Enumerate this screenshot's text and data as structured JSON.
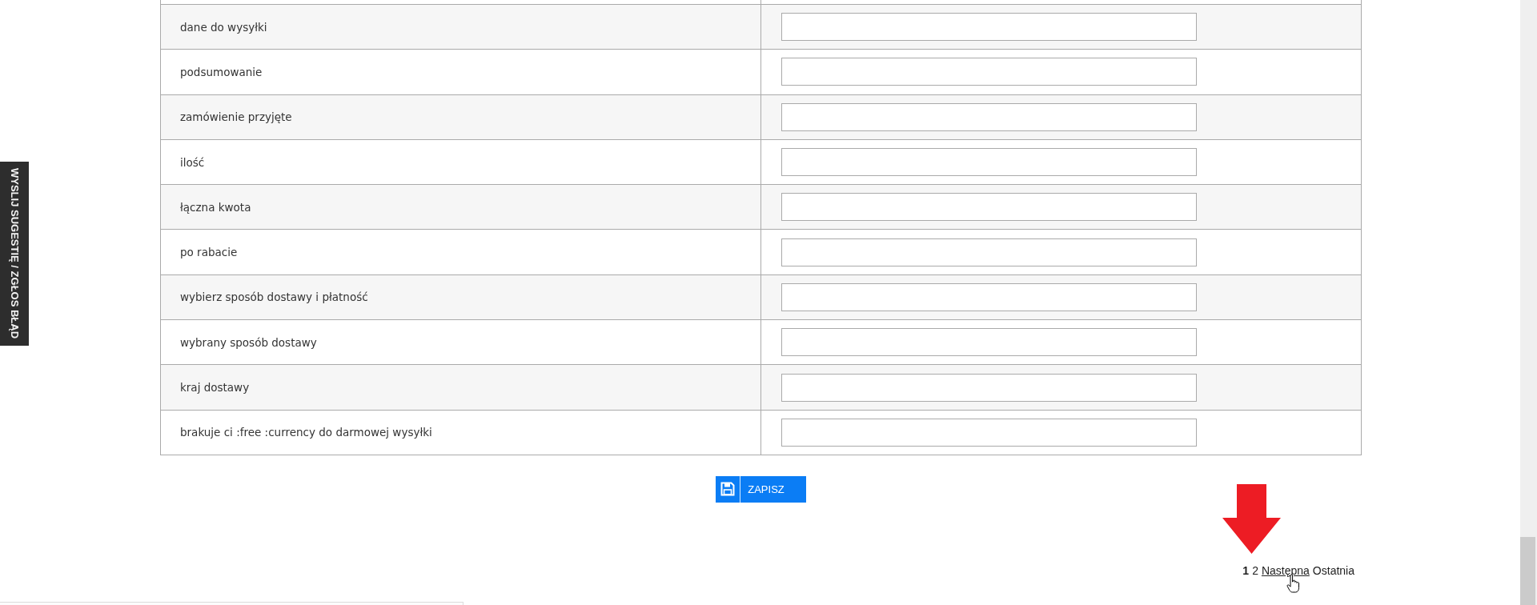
{
  "feedback_tab": {
    "label": "WYSLIJ SUGESTIĘ / ZGŁOS BŁĄD"
  },
  "form": {
    "rows": [
      {
        "label": "dane do wysyłki"
      },
      {
        "label": "podsumowanie"
      },
      {
        "label": "zamówienie przyjęte"
      },
      {
        "label": "ilość"
      },
      {
        "label": "łączna kwota"
      },
      {
        "label": "po rabacie"
      },
      {
        "label": "wybierz sposób dostawy i płatność"
      },
      {
        "label": "wybrany sposób dostawy"
      },
      {
        "label": "kraj dostawy"
      },
      {
        "label": "brakuje ci :free :currency do darmowej wysyłki"
      }
    ]
  },
  "save_button": {
    "label": "ZAPISZ"
  },
  "pagination": {
    "pages": [
      {
        "label": "1",
        "selected": true
      },
      {
        "label": "2",
        "selected": false
      }
    ],
    "links": [
      {
        "label": "Następna",
        "hovered": true
      },
      {
        "label": "Ostatnia",
        "hovered": false
      }
    ]
  }
}
